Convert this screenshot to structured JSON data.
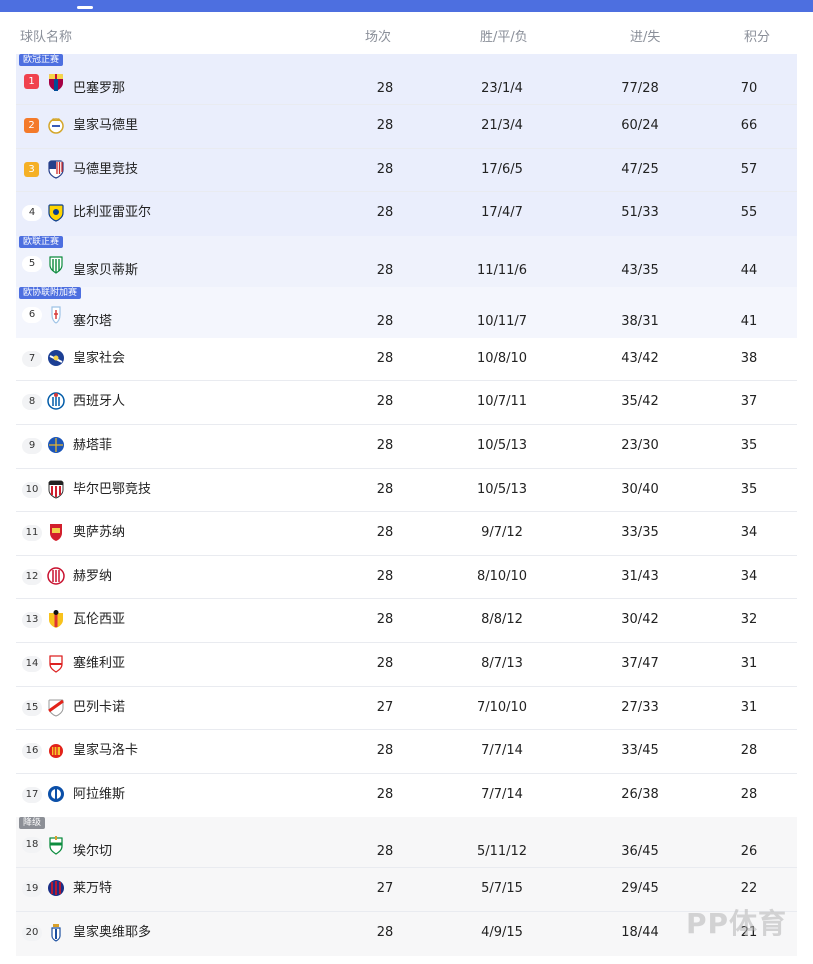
{
  "header": {
    "team": "球队名称",
    "played": "场次",
    "wdl": "胜/平/负",
    "goals": "进/失",
    "points": "积分"
  },
  "zones": [
    {
      "key": "ucl",
      "label": "欧冠正赛",
      "rows": [
        {
          "rank": "1",
          "badge": "r1",
          "team": "巴塞罗那",
          "logo": "barcelona-logo",
          "played": "28",
          "wdl": "23/1/4",
          "goals": "77/28",
          "points": "70"
        },
        {
          "rank": "2",
          "badge": "r2",
          "team": "皇家马德里",
          "logo": "real-madrid-logo",
          "played": "28",
          "wdl": "21/3/4",
          "goals": "60/24",
          "points": "66"
        },
        {
          "rank": "3",
          "badge": "r3",
          "team": "马德里竞技",
          "logo": "atletico-madrid-logo",
          "played": "28",
          "wdl": "17/6/5",
          "goals": "47/25",
          "points": "57"
        },
        {
          "rank": "4",
          "badge": "",
          "team": "比利亚雷亚尔",
          "logo": "villarreal-logo",
          "played": "28",
          "wdl": "17/4/7",
          "goals": "51/33",
          "points": "55"
        }
      ]
    },
    {
      "key": "uel",
      "label": "欧联正赛",
      "rows": [
        {
          "rank": "5",
          "badge": "",
          "team": "皇家贝蒂斯",
          "logo": "real-betis-logo",
          "played": "28",
          "wdl": "11/11/6",
          "goals": "43/35",
          "points": "44"
        }
      ]
    },
    {
      "key": "uecl",
      "label": "欧协联附加赛",
      "rows": [
        {
          "rank": "6",
          "badge": "",
          "team": "塞尔塔",
          "logo": "celta-logo",
          "played": "28",
          "wdl": "10/11/7",
          "goals": "38/31",
          "points": "41"
        }
      ]
    },
    {
      "key": "none",
      "label": "",
      "rows": [
        {
          "rank": "7",
          "badge": "",
          "team": "皇家社会",
          "logo": "real-sociedad-logo",
          "played": "28",
          "wdl": "10/8/10",
          "goals": "43/42",
          "points": "38"
        },
        {
          "rank": "8",
          "badge": "",
          "team": "西班牙人",
          "logo": "espanyol-logo",
          "played": "28",
          "wdl": "10/7/11",
          "goals": "35/42",
          "points": "37"
        },
        {
          "rank": "9",
          "badge": "",
          "team": "赫塔菲",
          "logo": "getafe-logo",
          "played": "28",
          "wdl": "10/5/13",
          "goals": "23/30",
          "points": "35"
        },
        {
          "rank": "10",
          "badge": "",
          "team": "毕尔巴鄂竞技",
          "logo": "athletic-bilbao-logo",
          "played": "28",
          "wdl": "10/5/13",
          "goals": "30/40",
          "points": "35"
        },
        {
          "rank": "11",
          "badge": "",
          "team": "奥萨苏纳",
          "logo": "osasuna-logo",
          "played": "28",
          "wdl": "9/7/12",
          "goals": "33/35",
          "points": "34"
        },
        {
          "rank": "12",
          "badge": "",
          "team": "赫罗纳",
          "logo": "girona-logo",
          "played": "28",
          "wdl": "8/10/10",
          "goals": "31/43",
          "points": "34"
        },
        {
          "rank": "13",
          "badge": "",
          "team": "瓦伦西亚",
          "logo": "valencia-logo",
          "played": "28",
          "wdl": "8/8/12",
          "goals": "30/42",
          "points": "32"
        },
        {
          "rank": "14",
          "badge": "",
          "team": "塞维利亚",
          "logo": "sevilla-logo",
          "played": "28",
          "wdl": "8/7/13",
          "goals": "37/47",
          "points": "31"
        },
        {
          "rank": "15",
          "badge": "",
          "team": "巴列卡诺",
          "logo": "rayo-vallecano-logo",
          "played": "27",
          "wdl": "7/10/10",
          "goals": "27/33",
          "points": "31"
        },
        {
          "rank": "16",
          "badge": "",
          "team": "皇家马洛卡",
          "logo": "mallorca-logo",
          "played": "28",
          "wdl": "7/7/14",
          "goals": "33/45",
          "points": "28"
        },
        {
          "rank": "17",
          "badge": "",
          "team": "阿拉维斯",
          "logo": "alaves-logo",
          "played": "28",
          "wdl": "7/7/14",
          "goals": "26/38",
          "points": "28"
        }
      ]
    },
    {
      "key": "rel",
      "label": "降级",
      "rows": [
        {
          "rank": "18",
          "badge": "",
          "team": "埃尔切",
          "logo": "elche-logo",
          "played": "28",
          "wdl": "5/11/12",
          "goals": "36/45",
          "points": "26"
        },
        {
          "rank": "19",
          "badge": "",
          "team": "莱万特",
          "logo": "levante-logo",
          "played": "27",
          "wdl": "5/7/15",
          "goals": "29/45",
          "points": "22"
        },
        {
          "rank": "20",
          "badge": "",
          "team": "皇家奥维耶多",
          "logo": "oviedo-logo",
          "played": "28",
          "wdl": "4/9/15",
          "goals": "18/44",
          "points": "21"
        }
      ]
    }
  ],
  "watermark": "PP体育",
  "colors": {
    "accent": "#4d6fe0",
    "rank1": "#f0424e",
    "rank2": "#f47a2a",
    "rank3": "#f5b025"
  }
}
